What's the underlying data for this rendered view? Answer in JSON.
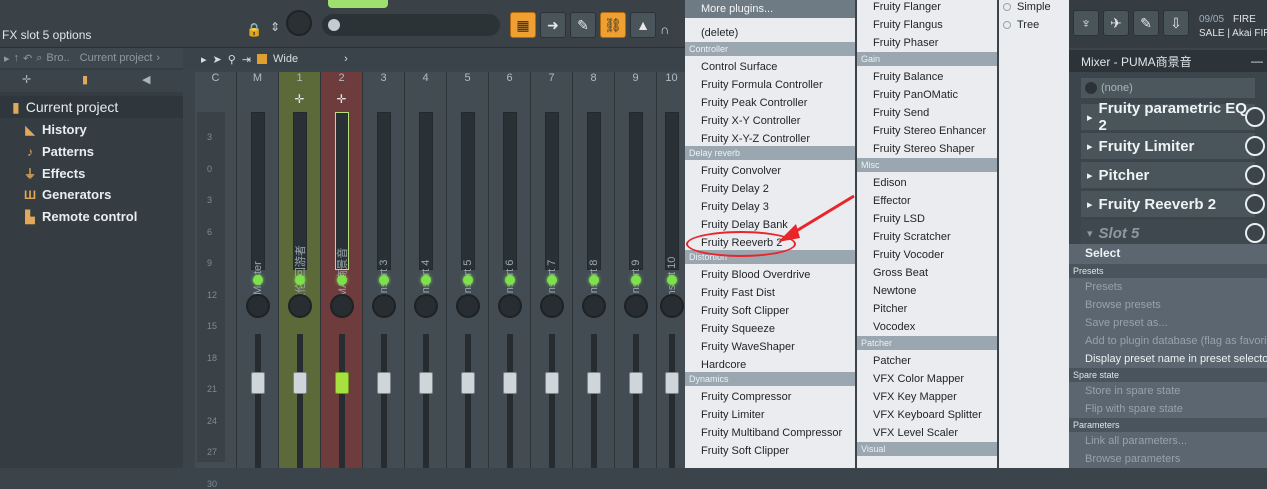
{
  "topbar": {
    "fx_title": "FX slot 5 options"
  },
  "browser": {
    "toolbar_text": "Bro..",
    "toolbar_path": "Current project",
    "current": "Current project",
    "tree": [
      {
        "label": "History",
        "icon": "history-icon"
      },
      {
        "label": "Patterns",
        "icon": "note-icon"
      },
      {
        "label": "Effects",
        "icon": "plug-icon"
      },
      {
        "label": "Generators",
        "icon": "piano-icon"
      },
      {
        "label": "Remote control",
        "icon": "remote-icon"
      }
    ]
  },
  "mixer_toolbar": {
    "mode": "Wide"
  },
  "db_scale": [
    "3",
    "0",
    "3",
    "6",
    "9",
    "12",
    "15",
    "18",
    "21",
    "24",
    "27",
    "30"
  ],
  "strips": [
    {
      "num": "C",
      "label": ""
    },
    {
      "num": "M",
      "label": "Master"
    },
    {
      "num": "1",
      "label": "周杰伦-回游者"
    },
    {
      "num": "2",
      "label": "PUMA商景音"
    },
    {
      "num": "3",
      "label": "Insert 3"
    },
    {
      "num": "4",
      "label": "Insert 4"
    },
    {
      "num": "5",
      "label": "Insert 5"
    },
    {
      "num": "6",
      "label": "Insert 6"
    },
    {
      "num": "7",
      "label": "Insert 7"
    },
    {
      "num": "8",
      "label": "Insert 8"
    },
    {
      "num": "9",
      "label": "Insert 9"
    },
    {
      "num": "10",
      "label": "Insert 10"
    }
  ],
  "menu1": {
    "more": "More plugins...",
    "delete": "(delete)",
    "sections": [
      {
        "header": "Controller",
        "items": [
          "Control Surface",
          "Fruity Formula Controller",
          "Fruity Peak Controller",
          "Fruity X-Y Controller",
          "Fruity X-Y-Z Controller"
        ]
      },
      {
        "header": "Delay reverb",
        "items": [
          "Fruity Convolver",
          "Fruity Delay 2",
          "Fruity Delay 3",
          "Fruity Delay Bank",
          "Fruity Reeverb 2"
        ]
      },
      {
        "header": "Distortion",
        "items": [
          "Fruity Blood Overdrive",
          "Fruity Fast Dist",
          "Fruity Soft Clipper",
          "Fruity Squeeze",
          "Fruity WaveShaper",
          "Hardcore"
        ]
      },
      {
        "header": "Dynamics",
        "items": [
          "Fruity Compressor",
          "Fruity Limiter",
          "Fruity Multiband Compressor",
          "Fruity Soft Clipper"
        ]
      }
    ]
  },
  "menu2": {
    "top_items": [
      "Fruity Flanger",
      "Fruity Flangus",
      "Fruity Phaser"
    ],
    "sections": [
      {
        "header": "Gain",
        "items": [
          "Fruity Balance",
          "Fruity PanOMatic",
          "Fruity Send",
          "Fruity Stereo Enhancer",
          "Fruity Stereo Shaper"
        ]
      },
      {
        "header": "Misc",
        "items": [
          "Edison",
          "Effector",
          "Fruity LSD",
          "Fruity Scratcher",
          "Fruity Vocoder",
          "Gross Beat",
          "Newtone",
          "Pitcher",
          "Vocodex"
        ]
      },
      {
        "header": "Patcher",
        "items": [
          "Patcher",
          "VFX Color Mapper",
          "VFX Key Mapper",
          "VFX Keyboard Splitter",
          "VFX Level Scaler"
        ]
      },
      {
        "header": "Visual",
        "items": []
      }
    ]
  },
  "menu3": {
    "items": [
      "Simple",
      "Tree"
    ]
  },
  "rpanel": {
    "date": "09/05",
    "promo1": "FIRE",
    "promo2": "SALE | Akai FIRE",
    "mixer_title": "Mixer - PUMA商景音",
    "none": "(none)",
    "slots": [
      "Fruity parametric EQ 2",
      "Fruity Limiter",
      "Pitcher",
      "Fruity Reeverb 2",
      "Slot 5"
    ],
    "select": "Select",
    "select_items": [
      {
        "type": "h",
        "text": "Presets"
      },
      {
        "type": "d",
        "text": "Presets"
      },
      {
        "type": "d",
        "text": "Browse presets"
      },
      {
        "type": "d",
        "text": "Save preset as..."
      },
      {
        "type": "d",
        "text": "Add to plugin database (flag as favorite)"
      },
      {
        "type": "e",
        "text": "Display preset name in preset selector"
      },
      {
        "type": "h",
        "text": "Spare state"
      },
      {
        "type": "d",
        "text": "Store in spare state"
      },
      {
        "type": "d",
        "text": "Flip with spare state"
      },
      {
        "type": "h",
        "text": "Parameters"
      },
      {
        "type": "d",
        "text": "Link all parameters..."
      },
      {
        "type": "d",
        "text": "Browse parameters"
      }
    ]
  },
  "colors": {
    "accent": "#f0a030",
    "highlight_red": "#e8252a",
    "strip1": "#5c6a3a",
    "strip2": "#6e3c3c"
  }
}
